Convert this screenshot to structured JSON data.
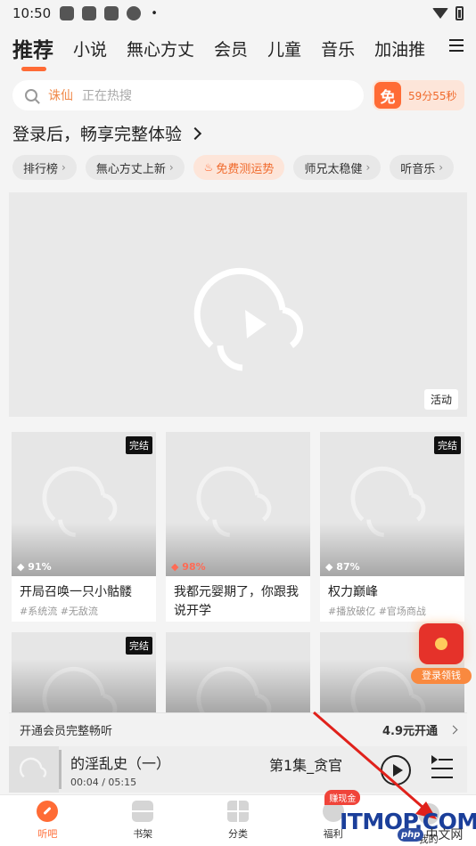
{
  "status_bar": {
    "time": "10:50",
    "dot": "•"
  },
  "top_tabs": [
    "推荐",
    "小说",
    "無心方丈",
    "会员",
    "儿童",
    "音乐",
    "加油推"
  ],
  "search": {
    "keyword": "诛仙",
    "placeholder": "正在热搜"
  },
  "free_badge": {
    "icon_text": "免",
    "timer": "59分55秒"
  },
  "login_prompt": "登录后，畅享完整体验",
  "chips": [
    "排行榜",
    "無心方丈上新",
    "免费测运势",
    "师兄太稳健",
    "听音乐"
  ],
  "banner": {
    "tag": "活动"
  },
  "cards": [
    {
      "title": "开局召唤一只小骷髅",
      "tags": "#系统流 #无敌流",
      "percent": "91%",
      "done": "完结"
    },
    {
      "title": "我都元婴期了，你跟我说开学",
      "tags": "",
      "percent": "98%",
      "done": ""
    },
    {
      "title": "权力巅峰",
      "tags": "#播放破亿 #官场商战",
      "percent": "87%",
      "done": "完结"
    }
  ],
  "row2_done": "完结",
  "float_reward": {
    "label": "登录领钱"
  },
  "vip_bar": {
    "text": "开通会员完整畅听",
    "price": "4.9元开通"
  },
  "player": {
    "title": "的淫乱史（一）",
    "time": "00:04 / 05:15",
    "episode": "第1集_贪官"
  },
  "bottom_nav": {
    "listen": "听吧",
    "shelf": "书架",
    "category": "分类",
    "welfare": "福利",
    "me": "我的",
    "earn_badge": "赚现金"
  },
  "watermark": {
    "main": "ITMOP.COM",
    "php": "php",
    "cn": "中文网"
  },
  "colors": {
    "accent": "#ff6b35",
    "annotation_arrow": "#e0211b",
    "watermark_blue": "#1b3f9a"
  }
}
